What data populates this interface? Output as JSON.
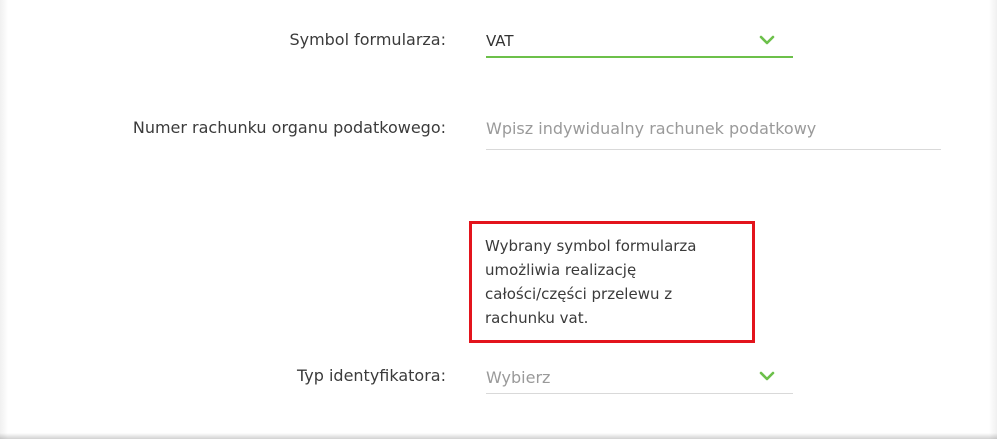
{
  "form": {
    "symbol": {
      "label": "Symbol formularza:",
      "value": "VAT",
      "icon": "chevron-down-icon"
    },
    "account": {
      "label": "Numer rachunku organu podatkowego:",
      "placeholder": "Wpisz indywidualny rachunek podatkowy"
    },
    "info": {
      "text": "Wybrany symbol formularza umożliwia realizację całości/części przelewu z rachunku vat."
    },
    "identifier_type": {
      "label": "Typ identyfikatora:",
      "placeholder": "Wybierz",
      "icon": "chevron-down-icon"
    }
  },
  "colors": {
    "accent": "#6cc04a",
    "highlight_border": "#e3141c",
    "label_text": "#3b3b3b",
    "placeholder_text": "#9a9a9a"
  }
}
